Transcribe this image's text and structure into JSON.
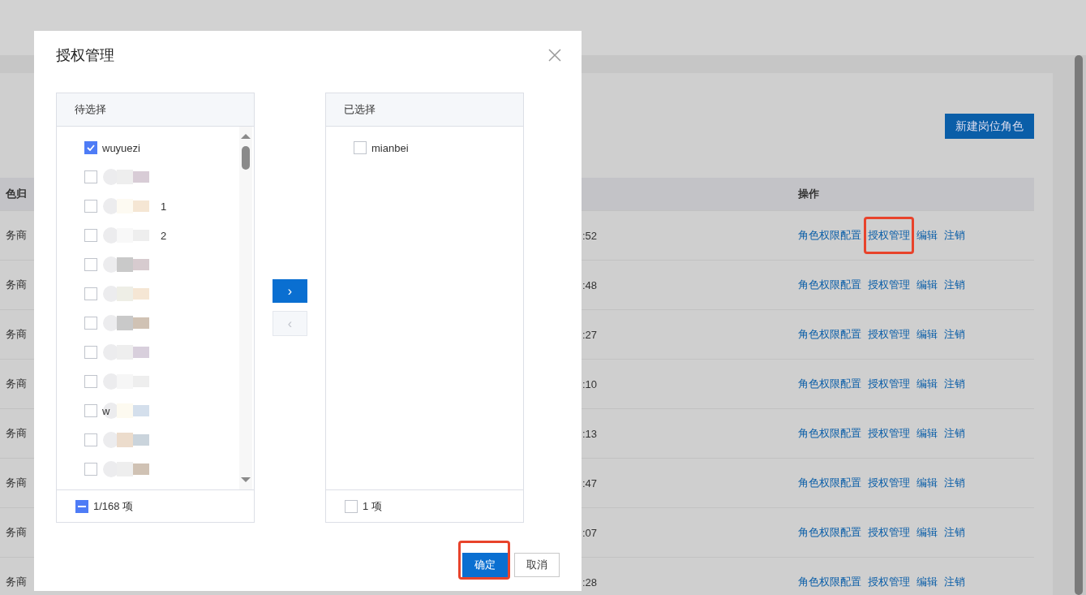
{
  "page": {
    "new_button": "新建岗位角色",
    "table": {
      "columns": [
        "色归",
        "操作"
      ],
      "rows": [
        {
          "owner": "务商",
          "time": ":52",
          "actions": [
            {
              "label": "角色权限配置",
              "highlighted": false
            },
            {
              "label": "授权管理",
              "highlighted": true
            },
            {
              "label": "编辑",
              "highlighted": false
            },
            {
              "label": "注销",
              "highlighted": false
            }
          ]
        },
        {
          "owner": "务商",
          "time": ":48",
          "actions": [
            {
              "label": "角色权限配置",
              "highlighted": false
            },
            {
              "label": "授权管理",
              "highlighted": false
            },
            {
              "label": "编辑",
              "highlighted": false
            },
            {
              "label": "注销",
              "highlighted": false
            }
          ]
        },
        {
          "owner": "务商",
          "time": ":27",
          "actions": [
            {
              "label": "角色权限配置",
              "highlighted": false
            },
            {
              "label": "授权管理",
              "highlighted": false
            },
            {
              "label": "编辑",
              "highlighted": false
            },
            {
              "label": "注销",
              "highlighted": false
            }
          ]
        },
        {
          "owner": "务商",
          "time": ":10",
          "actions": [
            {
              "label": "角色权限配置",
              "highlighted": false
            },
            {
              "label": "授权管理",
              "highlighted": false
            },
            {
              "label": "编辑",
              "highlighted": false
            },
            {
              "label": "注销",
              "highlighted": false
            }
          ]
        },
        {
          "owner": "务商",
          "time": ":13",
          "actions": [
            {
              "label": "角色权限配置",
              "highlighted": false
            },
            {
              "label": "授权管理",
              "highlighted": false
            },
            {
              "label": "编辑",
              "highlighted": false
            },
            {
              "label": "注销",
              "highlighted": false
            }
          ]
        },
        {
          "owner": "务商",
          "time": ":47",
          "actions": [
            {
              "label": "角色权限配置",
              "highlighted": false
            },
            {
              "label": "授权管理",
              "highlighted": false
            },
            {
              "label": "编辑",
              "highlighted": false
            },
            {
              "label": "注销",
              "highlighted": false
            }
          ]
        },
        {
          "owner": "务商",
          "time": ":07",
          "actions": [
            {
              "label": "角色权限配置",
              "highlighted": false
            },
            {
              "label": "授权管理",
              "highlighted": false
            },
            {
              "label": "编辑",
              "highlighted": false
            },
            {
              "label": "注销",
              "highlighted": false
            }
          ]
        },
        {
          "owner": "务商",
          "time": ":28",
          "actions": [
            {
              "label": "角色权限配置",
              "highlighted": false
            },
            {
              "label": "授权管理",
              "highlighted": false
            },
            {
              "label": "编辑",
              "highlighted": false
            },
            {
              "label": "注销",
              "highlighted": false
            }
          ]
        }
      ]
    }
  },
  "dialog": {
    "title": "授权管理",
    "source": {
      "title": "待选择",
      "footer": "1/168 项",
      "partly_checked": true,
      "items": [
        {
          "label": "wuyuezi",
          "checked": true
        },
        {
          "checked": false
        },
        {
          "label": "1",
          "checked": false
        },
        {
          "label": "2",
          "checked": false
        },
        {
          "checked": false
        },
        {
          "checked": false
        },
        {
          "checked": false
        },
        {
          "checked": false
        },
        {
          "checked": false
        },
        {
          "label": "w",
          "checked": false
        },
        {
          "checked": false
        },
        {
          "checked": false
        }
      ]
    },
    "move_right": {
      "label": "›",
      "disabled": false
    },
    "move_left": {
      "label": "‹",
      "disabled": true
    },
    "target": {
      "title": "已选择",
      "footer": "1 项",
      "partly_checked": false,
      "items": [
        {
          "label": "mianbei",
          "checked": false
        }
      ]
    },
    "buttons": [
      {
        "label": "确定",
        "kind": "primary",
        "highlighted": true
      },
      {
        "label": "取消",
        "kind": "default",
        "highlighted": false
      }
    ]
  }
}
